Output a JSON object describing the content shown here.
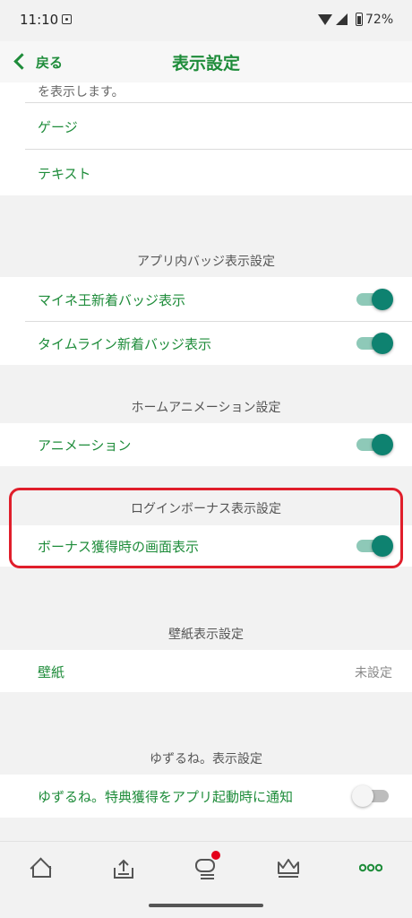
{
  "status_bar": {
    "time": "11:10",
    "battery": "72%"
  },
  "nav": {
    "back_label": "戻る",
    "title": "表示設定"
  },
  "top_section": {
    "cut_text": "を表示します。",
    "options": [
      "ゲージ",
      "テキスト"
    ]
  },
  "badge_section": {
    "header": "アプリ内バッジ表示設定",
    "items": [
      {
        "label": "マイネ王新着バッジ表示",
        "on": true
      },
      {
        "label": "タイムライン新着バッジ表示",
        "on": true
      }
    ]
  },
  "animation_section": {
    "header": "ホームアニメーション設定",
    "items": [
      {
        "label": "アニメーション",
        "on": true
      }
    ]
  },
  "bonus_section": {
    "header": "ログインボーナス表示設定",
    "items": [
      {
        "label": "ボーナス獲得時の画面表示",
        "on": true
      }
    ]
  },
  "wallpaper_section": {
    "header": "壁紙表示設定",
    "label": "壁紙",
    "value": "未設定"
  },
  "yuzurune_section": {
    "header": "ゆずるね。表示設定",
    "items": [
      {
        "label": "ゆずるね。特典獲得をアプリ起動時に通知",
        "on": false
      }
    ]
  },
  "colors": {
    "accent": "#1e8c3a",
    "toggle_on": "#0e8270",
    "highlight": "#e01e2b",
    "notification_dot": "#e4001b"
  },
  "tab_bar": {
    "tabs": [
      {
        "icon": "home-icon",
        "active": false
      },
      {
        "icon": "upload-tray-icon",
        "active": false
      },
      {
        "icon": "chat-icon",
        "active": false,
        "has_notification": true
      },
      {
        "icon": "crown-icon",
        "active": false
      },
      {
        "icon": "more-dots-icon",
        "active": true
      }
    ]
  }
}
